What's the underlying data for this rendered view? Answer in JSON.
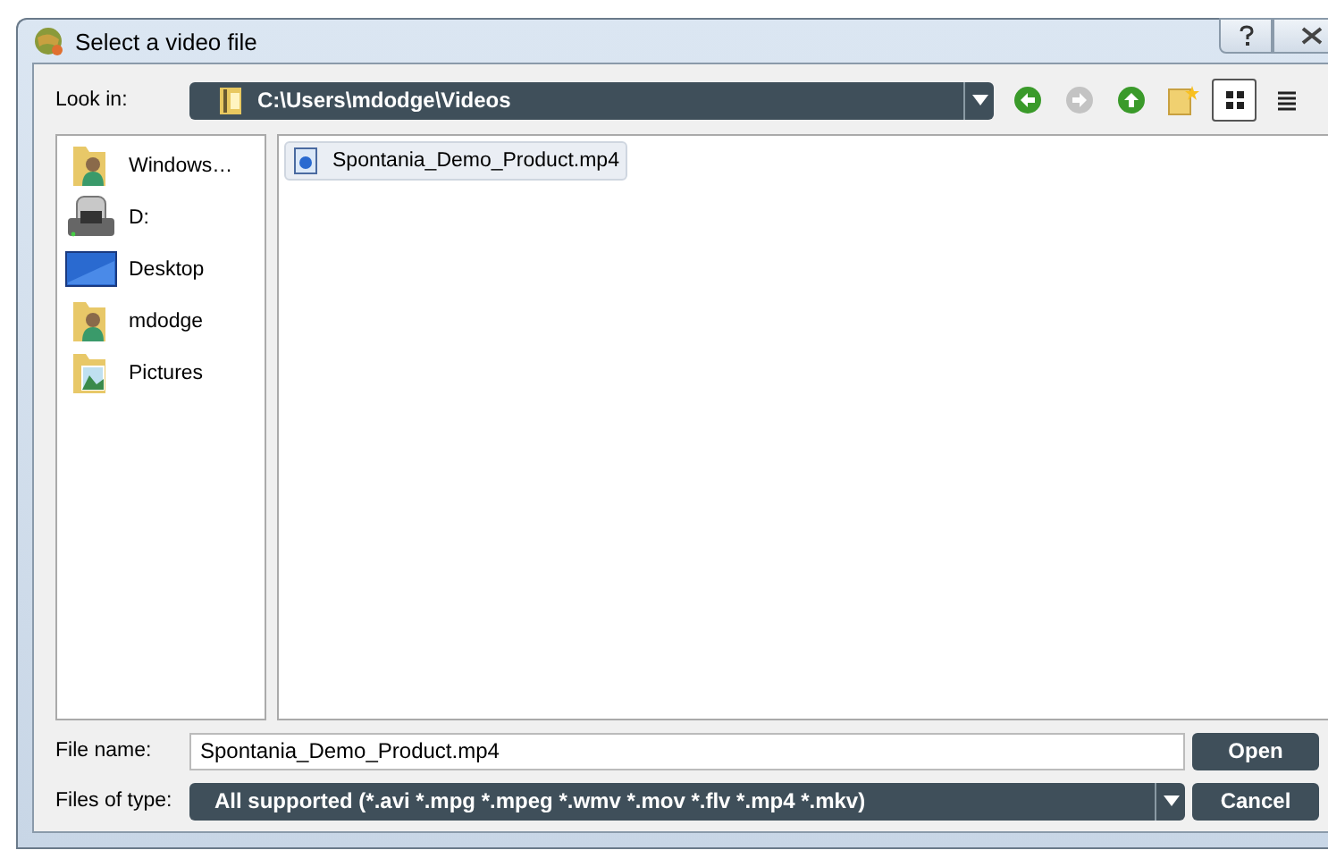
{
  "window": {
    "title": "Select a video file"
  },
  "look_in": {
    "label": "Look in:",
    "value": "C:\\Users\\mdodge\\Videos"
  },
  "toolbar": [
    {
      "kind": "back",
      "disabled": false,
      "selected": false
    },
    {
      "kind": "forward",
      "disabled": true,
      "selected": false
    },
    {
      "kind": "up",
      "disabled": false,
      "selected": false
    },
    {
      "kind": "new-folder",
      "disabled": false,
      "selected": false
    },
    {
      "kind": "list-view",
      "disabled": false,
      "selected": true
    },
    {
      "kind": "detail-view",
      "disabled": false,
      "selected": false
    }
  ],
  "sidebar": {
    "items": [
      {
        "label": "Windows…",
        "kind": "user-folder"
      },
      {
        "label": "D:",
        "kind": "drive"
      },
      {
        "label": "Desktop",
        "kind": "desktop"
      },
      {
        "label": "mdodge",
        "kind": "user-folder"
      },
      {
        "label": "Pictures",
        "kind": "pictures-folder"
      }
    ]
  },
  "files": [
    {
      "name": "Spontania_Demo_Product.mp4",
      "selected": true
    }
  ],
  "file_name": {
    "label": "File name:",
    "value": "Spontania_Demo_Product.mp4"
  },
  "file_type": {
    "label": "Files of type:",
    "value": "All supported (*.avi *.mpg *.mpeg *.wmv *.mov *.flv *.mp4 *.mkv)"
  },
  "buttons": [
    "Open",
    "Cancel"
  ]
}
